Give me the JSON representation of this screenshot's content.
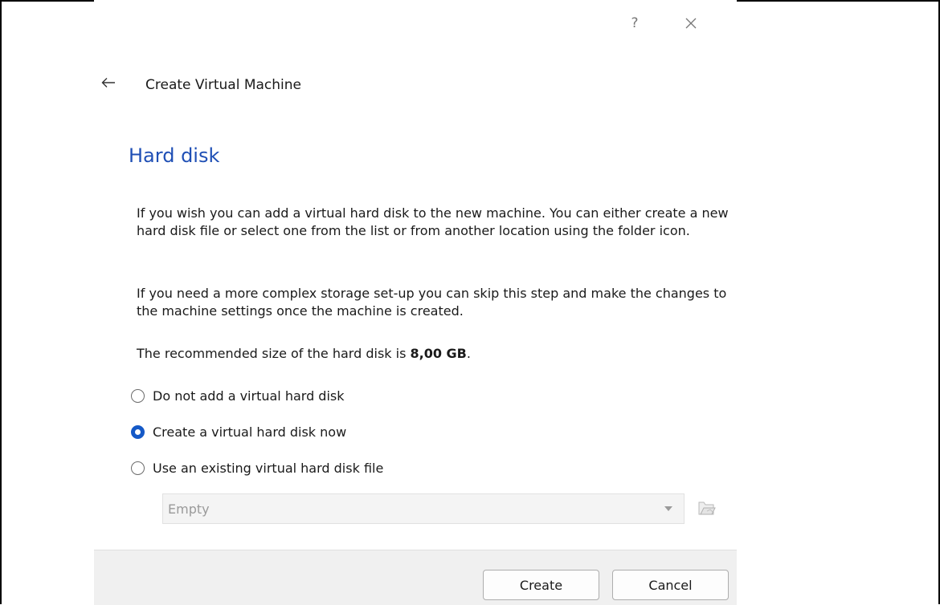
{
  "window": {
    "help_label": "?",
    "close_icon": "close-icon",
    "back_icon": "arrow-left-icon",
    "wizard_title": "Create Virtual Machine"
  },
  "page": {
    "title": "Hard disk",
    "description_1": "If you wish you can add a virtual hard disk to the new machine. You can either create a new hard disk file or select one from the list or from another location using the folder icon.",
    "description_2": "If you need a more complex storage set-up you can skip this step and make the changes to the machine settings once the machine is created.",
    "recommended_prefix": "The recommended size of the hard disk is ",
    "recommended_size": "8,00 GB",
    "recommended_suffix": "."
  },
  "options": {
    "selected_index": 1,
    "items": [
      {
        "label": "Do not add a virtual hard disk",
        "checked": false
      },
      {
        "label": "Create a virtual hard disk now",
        "checked": true
      },
      {
        "label": "Use an existing virtual hard disk file",
        "checked": false
      }
    ]
  },
  "disk_selector": {
    "value": "Empty",
    "enabled": false,
    "folder_icon": "folder-open-icon"
  },
  "footer": {
    "create_label": "Create",
    "cancel_label": "Cancel"
  },
  "colors": {
    "accent": "#1559c7",
    "title_blue": "#1f4fb5",
    "footer_bg": "#f0f0f0"
  }
}
